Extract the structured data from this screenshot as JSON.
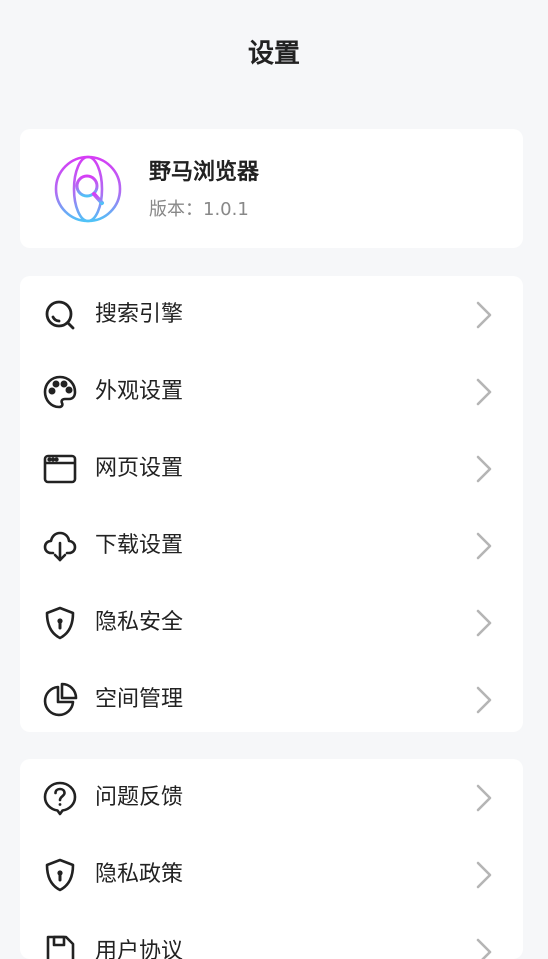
{
  "header": {
    "title": "设置"
  },
  "app": {
    "name": "野马浏览器",
    "version": "版本：1.0.1",
    "logo_icon": "globe-search-icon"
  },
  "menu_group_1": [
    {
      "label": "搜索引擎",
      "icon": "search-icon"
    },
    {
      "label": "外观设置",
      "icon": "palette-icon"
    },
    {
      "label": "网页设置",
      "icon": "browser-window-icon"
    },
    {
      "label": "下载设置",
      "icon": "cloud-download-icon"
    },
    {
      "label": "隐私安全",
      "icon": "shield-lock-icon"
    },
    {
      "label": "空间管理",
      "icon": "pie-chart-icon"
    }
  ],
  "menu_group_2": [
    {
      "label": "问题反馈",
      "icon": "question-bubble-icon"
    },
    {
      "label": "隐私政策",
      "icon": "shield-lock-icon"
    },
    {
      "label": "用户协议",
      "icon": "document-icon"
    }
  ],
  "colors": {
    "background": "#f6f7f9",
    "card": "#ffffff",
    "text": "#222222",
    "muted": "#888888",
    "chevron": "#b5b5b5",
    "logo_gradient": [
      "#e040fb",
      "#4fc3f7"
    ]
  }
}
